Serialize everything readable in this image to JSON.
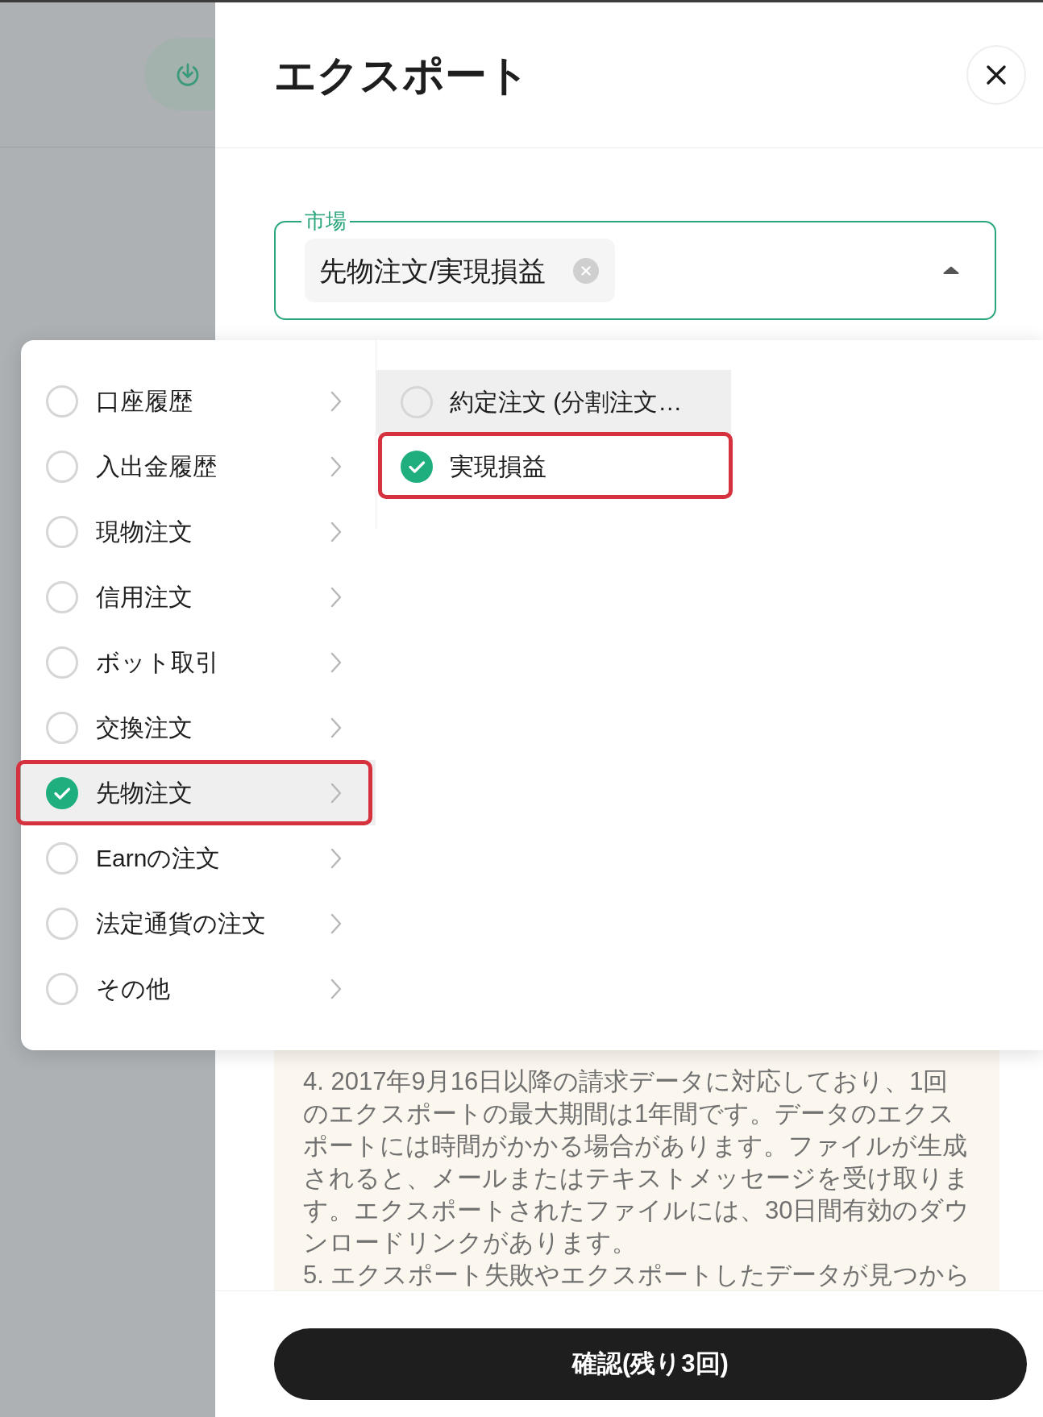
{
  "dialog": {
    "title": "エクスポート"
  },
  "market_field": {
    "label": "市場",
    "expanded": true,
    "tags": [
      {
        "text": "先物注文/実現損益"
      }
    ]
  },
  "category_menu": {
    "items": [
      {
        "label": "口座履歴",
        "checked": false,
        "selected": false,
        "highlighted": false
      },
      {
        "label": "入出金履歴",
        "checked": false,
        "selected": false,
        "highlighted": false
      },
      {
        "label": "現物注文",
        "checked": false,
        "selected": false,
        "highlighted": false
      },
      {
        "label": "信用注文",
        "checked": false,
        "selected": false,
        "highlighted": false
      },
      {
        "label": "ボット取引",
        "checked": false,
        "selected": false,
        "highlighted": false
      },
      {
        "label": "交換注文",
        "checked": false,
        "selected": false,
        "highlighted": false
      },
      {
        "label": "先物注文",
        "checked": true,
        "selected": true,
        "highlighted": true
      },
      {
        "label": "Earnの注文",
        "checked": false,
        "selected": false,
        "highlighted": false
      },
      {
        "label": "法定通貨の注文",
        "checked": false,
        "selected": false,
        "highlighted": false
      },
      {
        "label": "その他",
        "checked": false,
        "selected": false,
        "highlighted": false
      }
    ]
  },
  "submenu": {
    "items": [
      {
        "label": "約定注文 (分割注文…",
        "checked": false,
        "hovered": true,
        "highlighted": false
      },
      {
        "label": "実現損益",
        "checked": true,
        "hovered": false,
        "highlighted": true
      }
    ]
  },
  "notes": [
    "4. 2017年9月16日以降の請求データに対応しており、1回のエクスポートの最大期間は1年間です。データのエクスポートには時間がかかる場合があります。ファイルが生成されると、メールまたはテキストメッセージを受け取ります。エクスポートされたファイルには、30日間有効のダウンロードリンクがあります。",
    "5. エクスポート失敗やエクスポートしたデータが見つから"
  ],
  "confirm_button": {
    "label": "確認(残り3回)"
  }
}
